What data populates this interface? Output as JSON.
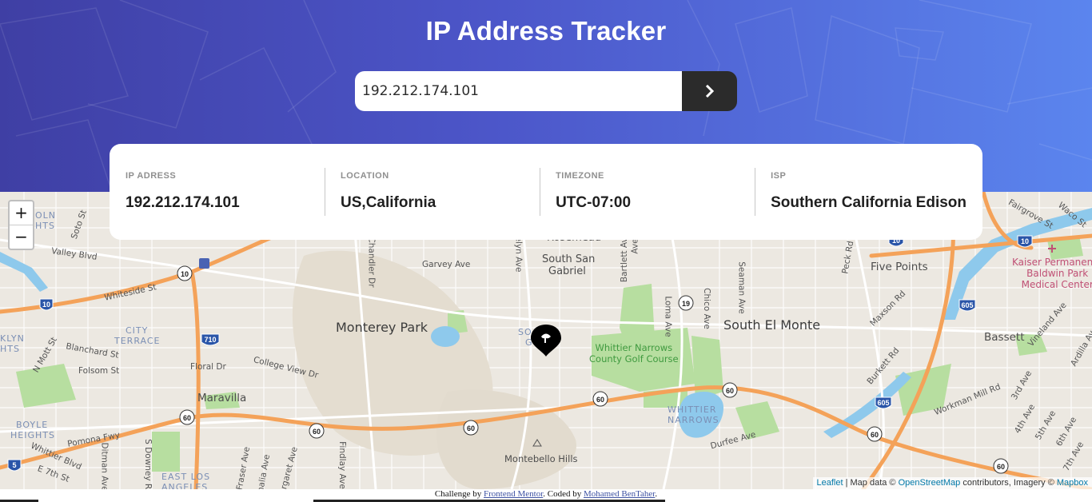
{
  "header": {
    "title": "IP Address Tracker",
    "search_value": "192.212.174.101",
    "submit_icon": "chevron-right-icon"
  },
  "info": {
    "ip_label": "IP ADRESS",
    "ip_value": "192.212.174.101",
    "location_label": "LOCATION",
    "location_value": "US,California",
    "timezone_label": "TIMEZONE",
    "timezone_value": "UTC-07:00",
    "isp_label": "ISP",
    "isp_value": "Southern California Edison"
  },
  "map": {
    "zoom_in": "+",
    "zoom_out": "−",
    "labels": {
      "rosemead": "Rosemead",
      "south_san_gabriel": "South San",
      "south_san_gabriel_2": "Gabriel",
      "monterey_park": "Monterey Park",
      "south_el_monte": "South El Monte",
      "five_points": "Five Points",
      "bassett": "Bassett",
      "maravilla": "Maravilla",
      "city_terrace": "CITY",
      "city_terrace_2": "TERRACE",
      "boyle_heights": "BOYLE",
      "boyle_heights_2": "HEIGHTS",
      "east_los_angeles": "EAST LOS",
      "east_los_angeles_2": "ANGELES",
      "whittier_narrows": "WHITTIER",
      "whittier_narrows_2": "NARROWS",
      "san_gabriel_partial": "SO   SAN",
      "san_gabriel_partial_2": "G   L",
      "lincoln_heights": "OLN",
      "lincoln_heights_2": "HTS",
      "klyn": "KLYN",
      "klyn_2": "HTS",
      "montebello_hills": "Montebello Hills",
      "golf_course": "Whittier Narrows",
      "golf_course_2": "County Golf Course",
      "kaiser": "Kaiser Permanente",
      "kaiser_2": "Baldwin Park",
      "kaiser_3": "Medical Center",
      "garvey_ave": "Garvey Ave",
      "valley_blvd": "Valley Blvd",
      "whiteside_st": "Whiteside St",
      "blanchard_st": "Blanchard St",
      "folsom_st": "Folsom St",
      "n_mott_st": "N Mott St",
      "floral_dr": "Floral Dr",
      "college_view_dr": "College View Dr",
      "pomona_fwy": "Pomona Fwy",
      "whittier_blvd": "Whittier Blvd",
      "e_7th_st": "E 7th St",
      "ditman_ave": "Ditman Ave",
      "s_downey_rd": "S Downey Rd",
      "fraser_ave": "Fraser Ave",
      "malia_ave": "malia Ave",
      "margaret_ave": "Margaret Ave",
      "findlay_ave": "Findlay Ave",
      "chandler_dr": "Chandler Dr",
      "evelyn_ave": "elyn Ave",
      "bartlett_ave": "Bartlett Ave",
      "ave_partial": "Ave",
      "loma_ave": "Loma Ave",
      "chico_ave": "Chico Ave",
      "seaman_ave": "Seaman Ave",
      "peck_rd": "Peck Rd",
      "maxson_rd": "Maxson Rd",
      "burkett_rd": "Burkett Rd",
      "durfee_ave": "Durfee Ave",
      "workman_mill_rd": "Workman Mill Rd",
      "vineland_ave": "Vineland Ave",
      "ardilla_av": "Ardilla Av",
      "third_ave": "3rd Ave",
      "fourth_ave": "4th Ave",
      "fifth_ave": "5th Ave",
      "sixth_ave": "6th Ave",
      "seventh_ave": "7th Ave",
      "fairgrove_st": "Fairgrove St",
      "waco_st": "Waco St",
      "soto_st": "Soto St"
    },
    "shields": {
      "i10": "10",
      "i710": "710",
      "i605": "605",
      "i5": "5",
      "r60": "60",
      "r19": "19",
      "r10": "10"
    },
    "attribution_leaflet": "Leaflet",
    "attribution_sep": " | Map data © ",
    "attribution_osm": "OpenStreetMap",
    "attribution_mid": " contributors, Imagery © ",
    "attribution_mapbox": "Mapbox"
  },
  "credit": {
    "prefix": "Challenge by ",
    "fm": "Frontend Mentor",
    "mid": ". Coded by ",
    "author": "Mohamed BenTaher",
    "suffix": "."
  },
  "colors": {
    "header_start": "#3f3fa4",
    "header_end": "#5b85ee",
    "dark_button": "#2b2b2b",
    "freeway": "#f4a259",
    "park": "#b7dea0",
    "water": "#8ec9ec"
  }
}
